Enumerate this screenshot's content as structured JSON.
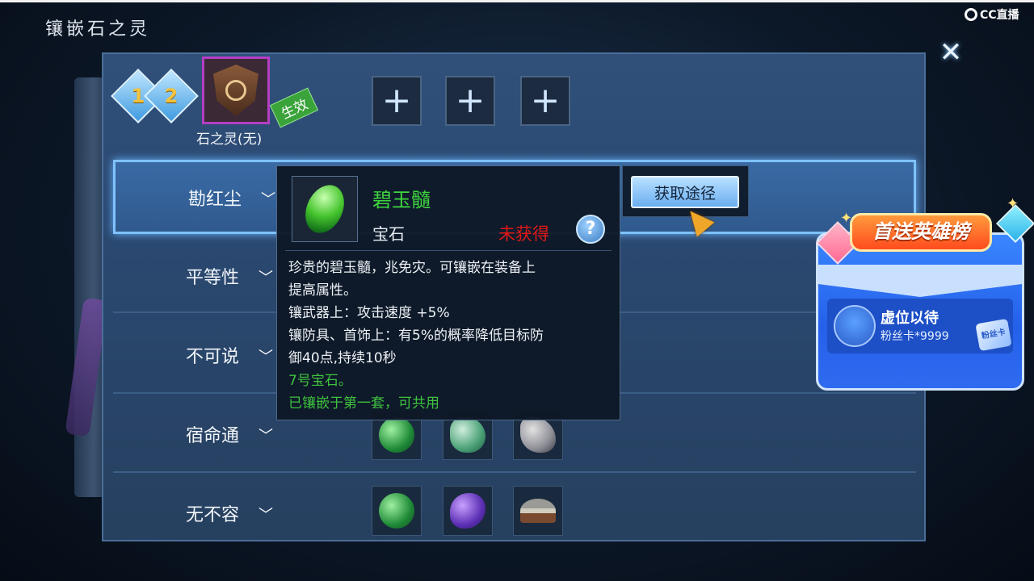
{
  "window": {
    "title": "镶嵌石之灵",
    "close_icon": "close-icon"
  },
  "stream": {
    "logo_text": "CC直播"
  },
  "levels": [
    "1",
    "2"
  ],
  "spirit": {
    "name": "石之灵(无)",
    "tag": "生效"
  },
  "slots": [
    "+",
    "+",
    "+"
  ],
  "categories": [
    {
      "label": "勘红尘",
      "chevron": "﹀"
    },
    {
      "label": "平等性",
      "chevron": "﹀"
    },
    {
      "label": "不可说",
      "chevron": "﹀"
    },
    {
      "label": "宿命通",
      "chevron": "﹀"
    },
    {
      "label": "无不容",
      "chevron": "﹀"
    }
  ],
  "tooltip": {
    "name": "碧玉髓",
    "type": "宝石",
    "status": "未获得",
    "help": "?",
    "desc": [
      "珍贵的碧玉髓，兆免灾。可镶嵌在装备上",
      "提高属性。",
      "镶武器上：攻击速度 +5%",
      "镶防具、首饰上：有5%的概率降低目标防",
      "御40点,持续10秒"
    ],
    "gem_no": "7号宝石。",
    "inlaid_note": "已镶嵌于第一套，可共用"
  },
  "acquire_button": {
    "label": "获取途径"
  },
  "promo": {
    "title": "首送英雄榜",
    "slot_name": "虚位以待",
    "reward": "粉丝卡*9999",
    "ticket": "粉丝卡"
  },
  "colors": {
    "accent": "#7fc2ff",
    "gem_name": "#3fd63f",
    "status": "#e01818",
    "purple_frame": "#b53ec4"
  }
}
